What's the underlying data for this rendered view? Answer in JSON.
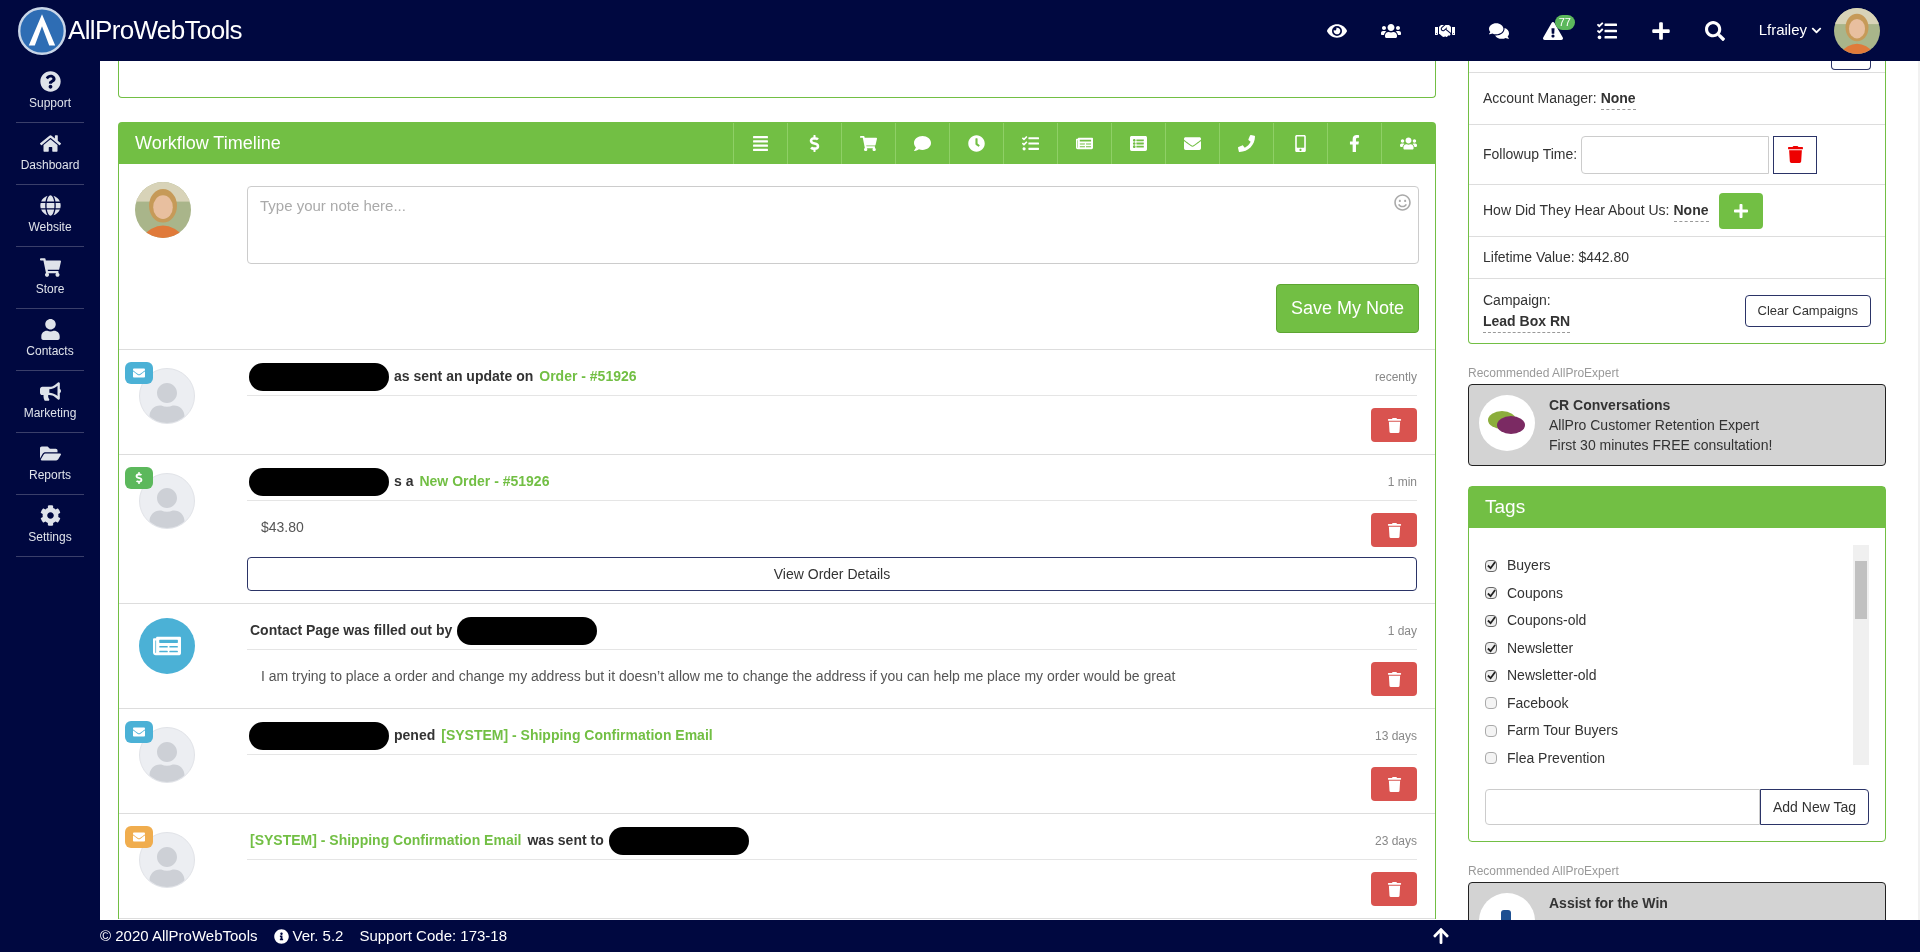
{
  "brand": {
    "name": "AllProWebTools"
  },
  "top_nav": {
    "alerts_badge": "77",
    "user": "Lfrailey"
  },
  "sidebar": {
    "items": [
      {
        "kind": "support",
        "label": "Support"
      },
      {
        "kind": "dashboard",
        "label": "Dashboard"
      },
      {
        "kind": "website",
        "label": "Website"
      },
      {
        "kind": "store",
        "label": "Store"
      },
      {
        "kind": "contacts",
        "label": "Contacts"
      },
      {
        "kind": "marketing",
        "label": "Marketing"
      },
      {
        "kind": "reports",
        "label": "Reports"
      },
      {
        "kind": "settings",
        "label": "Settings"
      }
    ]
  },
  "timeline": {
    "title": "Workflow Timeline",
    "note": {
      "placeholder": "Type your note here...",
      "save_button": "Save My Note"
    },
    "entries": [
      {
        "kind": "email",
        "color": "#4bb1d6",
        "parts": [
          {
            "kind": "redacted"
          },
          {
            "kind": "text",
            "text": "as sent an update on"
          },
          {
            "kind": "link",
            "text": "Order - #51926"
          }
        ],
        "time": "recently"
      },
      {
        "kind": "order",
        "color": "#5cb85c",
        "parts": [
          {
            "kind": "redacted"
          },
          {
            "kind": "text",
            "text": "s a"
          },
          {
            "kind": "link",
            "text": "New Order - #51926"
          }
        ],
        "time": "1 min",
        "body": "$43.80",
        "button": "View Order Details"
      },
      {
        "kind": "form",
        "parts": [
          {
            "kind": "text",
            "text": "Contact Page was filled out by"
          },
          {
            "kind": "redacted"
          }
        ],
        "time": "1 day",
        "body": "I am trying to place a order and change my address but it doesn’t allow me to change the address if you can help me place my order would be great"
      },
      {
        "kind": "email",
        "color": "#4bb1d6",
        "parts": [
          {
            "kind": "redacted"
          },
          {
            "kind": "text",
            "text": "pened"
          },
          {
            "kind": "link",
            "text": "[SYSTEM] - Shipping Confirmation Email"
          }
        ],
        "time": "13 days"
      },
      {
        "kind": "email",
        "color": "#f0ad4e",
        "parts": [
          {
            "kind": "link",
            "text": "[SYSTEM] - Shipping Confirmation Email"
          },
          {
            "kind": "text",
            "text": "was sent to"
          },
          {
            "kind": "redacted"
          }
        ],
        "time": "23 days"
      }
    ]
  },
  "contact_fields": [
    {
      "kind": "value",
      "label": "Account Manager:",
      "value": "None"
    },
    {
      "kind": "input",
      "label": "Followup Time:"
    },
    {
      "kind": "add",
      "label": "How Did They Hear About Us:",
      "value": "None"
    },
    {
      "kind": "plain",
      "label": "Lifetime Value: $442.80"
    },
    {
      "kind": "campaign",
      "label": "Campaign:",
      "value": "Lead Box RN",
      "button": "Clear Campaigns"
    }
  ],
  "experts": [
    {
      "heading": "Recommended AllProExpert",
      "title": "CR Conversations",
      "lines": [
        "AllPro Customer Retention Expert",
        "First 30 minutes FREE consultation!"
      ]
    },
    {
      "heading": "Recommended AllProExpert",
      "title": "Assist for the Win"
    }
  ],
  "tags": {
    "title": "Tags",
    "items": [
      {
        "label": "Buyers",
        "checked": true
      },
      {
        "label": "Coupons",
        "checked": true
      },
      {
        "label": "Coupons-old",
        "checked": true
      },
      {
        "label": "Newsletter",
        "checked": true
      },
      {
        "label": "Newsletter-old",
        "checked": true
      },
      {
        "label": "Facebook",
        "checked": false
      },
      {
        "label": "Farm Tour Buyers",
        "checked": false
      },
      {
        "label": "Flea Prevention",
        "checked": false
      }
    ],
    "add_button": "Add New Tag"
  },
  "footer": {
    "copyright": "© 2020 AllProWebTools",
    "version": "Ver. 5.2",
    "support_code": "Support Code: 173-18"
  }
}
